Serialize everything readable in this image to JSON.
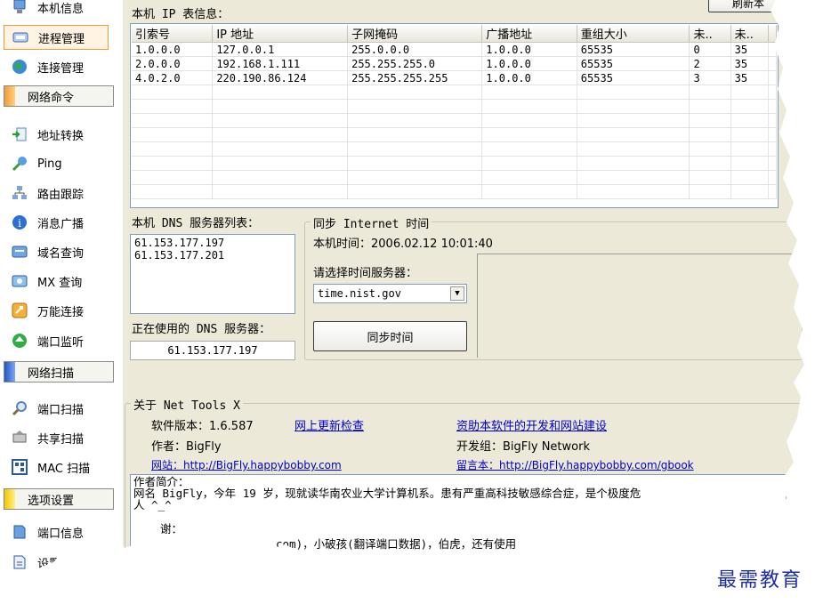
{
  "sidebar": {
    "items_top": [
      {
        "label": "本机信息",
        "icon": "info-icon"
      },
      {
        "label": "进程管理",
        "icon": "process-icon",
        "active": true
      },
      {
        "label": "连接管理",
        "icon": "globe-icon"
      }
    ],
    "group_network_cmd": "网络命令",
    "items_cmd": [
      {
        "label": "地址转换",
        "icon": "address-convert-icon"
      },
      {
        "label": "Ping",
        "icon": "ping-icon"
      },
      {
        "label": "路由跟踪",
        "icon": "route-trace-icon"
      },
      {
        "label": "消息广播",
        "icon": "broadcast-icon"
      },
      {
        "label": "域名查询",
        "icon": "domain-lookup-icon"
      },
      {
        "label": "MX 查询",
        "icon": "mx-lookup-icon"
      },
      {
        "label": "万能连接",
        "icon": "universal-connect-icon"
      },
      {
        "label": "端口监听",
        "icon": "port-listen-icon"
      }
    ],
    "group_network_scan": "网络扫描",
    "items_scan": [
      {
        "label": "端口扫描",
        "icon": "port-scan-icon"
      },
      {
        "label": "共享扫描",
        "icon": "share-scan-icon"
      },
      {
        "label": "MAC 扫描",
        "icon": "mac-scan-icon"
      }
    ],
    "group_options": "选项设置",
    "items_options": [
      {
        "label": "端口信息",
        "icon": "port-info-icon"
      },
      {
        "label": "设置选",
        "icon": "settings-icon"
      }
    ]
  },
  "ip_table": {
    "title": "本机 IP 表信息：",
    "refresh_label": "刷新本",
    "columns": [
      "引索号",
      "IP 地址",
      "子网掩码",
      "广播地址",
      "重组大小",
      "未..",
      "未.."
    ],
    "rows": [
      [
        "1.0.0.0",
        "127.0.0.1",
        "255.0.0.0",
        "1.0.0.0",
        "65535",
        "0",
        "35"
      ],
      [
        "2.0.0.0",
        "192.168.1.111",
        "255.255.255.0",
        "1.0.0.0",
        "65535",
        "2",
        "35"
      ],
      [
        "4.0.2.0",
        "220.190.86.124",
        "255.255.255.255",
        "1.0.0.0",
        "65535",
        "3",
        "35"
      ]
    ]
  },
  "dns": {
    "title": "本机 DNS 服务器列表：",
    "servers": [
      "61.153.177.197",
      "61.153.177.201"
    ],
    "in_use_label": "正在使用的 DNS 服务器：",
    "in_use_value": "61.153.177.197"
  },
  "sync": {
    "title": "同步 Internet 时间",
    "local_time": "本机时间：2006.02.12 10:01:40",
    "choose_label": "请选择时间服务器：",
    "server_selected": "time.nist.gov",
    "sync_button": "同步时间"
  },
  "about": {
    "title": "关于 Net Tools X",
    "version": "软件版本：1.6.587",
    "update_link": "网上更新检查",
    "sponsor_link": "资助本软件的开发和网站建设",
    "author": "作者：BigFly",
    "dev_group": "开发组：BigFly Network",
    "website_link": "网站：http://BigFly.happybobby.com",
    "guestbook_link": "留言本：http://BigFly.happybobby.com/gbook",
    "bio_title": "作者简介：",
    "bio_line1": "网名 BigFly，今年 19 岁，现就读华南农业大学计算机系。患有严重高科技敏感综合症，是个极度危",
    "bio_line2": "人 ^_^",
    "thanks_fragment": "谢：",
    "thanks_line": "com)，小破孩(翻译端口数据)，伯虎，还有使用"
  },
  "watermark": "最需教育",
  "colors": {
    "accent_orange": "#f29a3a",
    "scan_blue": "#1e58c8",
    "options_yellow": "#f5c400",
    "link_blue": "#0000cc"
  }
}
